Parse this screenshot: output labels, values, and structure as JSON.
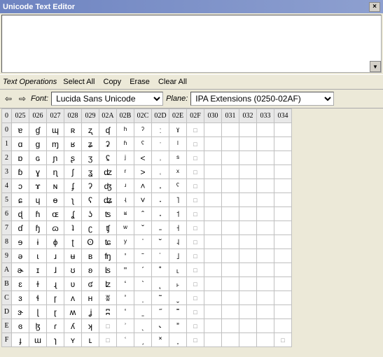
{
  "title": "Unicode Text Editor",
  "close_label": "×",
  "scrollbar_glyph": "▼",
  "ops": {
    "label": "Text Operations",
    "select_all": "Select All",
    "copy": "Copy",
    "erase": "Erase",
    "clear_all": "Clear All"
  },
  "nav": {
    "left": "⇦",
    "right": "⇨",
    "font_label": "Font:",
    "font_value": "Lucida Sans Unicode",
    "plane_label": "Plane:",
    "plane_value": "IPA Extensions (0250-02AF)"
  },
  "grid": {
    "corner": "0",
    "cols": [
      "025",
      "026",
      "027",
      "028",
      "029",
      "02A",
      "02B",
      "02C",
      "02D",
      "02E",
      "02F",
      "030",
      "031",
      "032",
      "033",
      "034"
    ],
    "rows": [
      "0",
      "1",
      "2",
      "3",
      "4",
      "5",
      "6",
      "7",
      "8",
      "9",
      "A",
      "B",
      "C",
      "D",
      "E",
      "F"
    ],
    "highlight": {
      "row": 2,
      "col": 14
    },
    "cells": [
      [
        "ɐ",
        "ɠ",
        "ɰ",
        "ʀ",
        "ʐ",
        "ʠ",
        "ʰ",
        "ˀ",
        "ː",
        "ˠ",
        "□",
        "",
        "",
        "",
        "",
        ""
      ],
      [
        "ɑ",
        "ɡ",
        "ɱ",
        "ʁ",
        "ʑ",
        "ʡ",
        "ʱ",
        "ˁ",
        "ˑ",
        "ˡ",
        "□",
        "",
        "",
        "",
        "",
        ""
      ],
      [
        "ɒ",
        "ɢ",
        "ɲ",
        "ʂ",
        "ʒ",
        "ʢ",
        "ʲ",
        "˂",
        "˒",
        "ˢ",
        "□",
        "",
        "",
        "",
        "",
        ""
      ],
      [
        "ɓ",
        "ɣ",
        "ɳ",
        "ʃ",
        "ʓ",
        "ʣ",
        "ʳ",
        "˃",
        "˓",
        "ˣ",
        "□",
        "",
        "",
        "",
        "",
        ""
      ],
      [
        "ɔ",
        "ɤ",
        "ɴ",
        "ʄ",
        "ʔ",
        "ʤ",
        "ʴ",
        "˄",
        "˔",
        "ˤ",
        "□",
        "",
        "",
        "",
        "",
        ""
      ],
      [
        "ɕ",
        "ɥ",
        "ɵ",
        "ʅ",
        "ʕ",
        "ʥ",
        "ʵ",
        "˅",
        "˕",
        "˥",
        "□",
        "",
        "",
        "",
        "",
        ""
      ],
      [
        "ɖ",
        "ɦ",
        "ɶ",
        "ʆ",
        "ʖ",
        "ʦ",
        "ʶ",
        "ˆ",
        "˖",
        "˦",
        "□",
        "",
        "",
        "",
        "",
        ""
      ],
      [
        "ɗ",
        "ɧ",
        "ɷ",
        "ʇ",
        "ʗ",
        "ʧ",
        "ʷ",
        "ˇ",
        "˗",
        "˧",
        "□",
        "",
        "",
        "",
        "",
        ""
      ],
      [
        "ɘ",
        "ɨ",
        "ɸ",
        "ʈ",
        "ʘ",
        "ʨ",
        "ʸ",
        "ˈ",
        "˘",
        "˨",
        "□",
        "",
        "",
        "",
        "",
        ""
      ],
      [
        "ə",
        "ɩ",
        "ɹ",
        "ʉ",
        "ʙ",
        "ʩ",
        "ʹ",
        "ˉ",
        "˙",
        "˩",
        "□",
        "",
        "",
        "",
        "",
        ""
      ],
      [
        "ɚ",
        "ɪ",
        "ɺ",
        "ʊ",
        "ʚ",
        "ʪ",
        "ʺ",
        "ˊ",
        "˚",
        "˪",
        "□",
        "",
        "",
        "",
        "",
        ""
      ],
      [
        "ɛ",
        "ɫ",
        "ɻ",
        "ʋ",
        "ʛ",
        "ʫ",
        "ʻ",
        "ˋ",
        "˛",
        "˫",
        "□",
        "",
        "",
        "",
        "",
        ""
      ],
      [
        "ɜ",
        "ɬ",
        "ɼ",
        "ʌ",
        "ʜ",
        "ʬ",
        "ʼ",
        "ˌ",
        "˜",
        "ˬ",
        "□",
        "",
        "",
        "",
        "",
        ""
      ],
      [
        "ɝ",
        "ɭ",
        "ɽ",
        "ʍ",
        "ʝ",
        "ʭ",
        "ʽ",
        "ˍ",
        "˝",
        "˭",
        "□",
        "",
        "",
        "",
        "",
        ""
      ],
      [
        "ɞ",
        "ɮ",
        "ɾ",
        "ʎ",
        "ʞ",
        "□",
        "ʾ",
        "ˎ",
        "˞",
        "ˮ",
        "□",
        "",
        "",
        "",
        "",
        ""
      ],
      [
        "ɟ",
        "ɯ",
        "ɿ",
        "ʏ",
        "ʟ",
        "□",
        "ʿ",
        "ˏ",
        "˟",
        "˯",
        "□",
        "",
        "",
        "",
        "",
        "□"
      ]
    ]
  }
}
